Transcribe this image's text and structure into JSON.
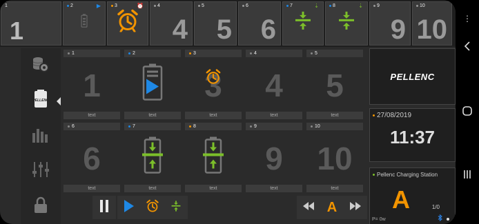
{
  "topbar": {
    "slots": [
      {
        "num": "1",
        "big": "1"
      },
      {
        "num": "2",
        "big": ""
      },
      {
        "num": "3",
        "big": ""
      },
      {
        "num": "4",
        "big": "4"
      },
      {
        "num": "5",
        "big": "5"
      },
      {
        "num": "6",
        "big": "6"
      },
      {
        "num": "7",
        "big": ""
      },
      {
        "num": "8",
        "big": ""
      },
      {
        "num": "9",
        "big": "9"
      },
      {
        "num": "10",
        "big": "10"
      }
    ]
  },
  "sidebar": {
    "items": [
      {
        "icon": "coins-settings-icon"
      },
      {
        "icon": "pellenc-battery-icon"
      },
      {
        "icon": "bar-chart-icon"
      },
      {
        "icon": "sliders-icon"
      },
      {
        "icon": "lock-icon"
      }
    ]
  },
  "grid": {
    "cells": [
      {
        "num": "1",
        "big": "1",
        "label": "text"
      },
      {
        "num": "2",
        "big": "",
        "label": "text"
      },
      {
        "num": "3",
        "big": "3",
        "label": "text"
      },
      {
        "num": "4",
        "big": "4",
        "label": "text"
      },
      {
        "num": "5",
        "big": "5",
        "label": "text"
      },
      {
        "num": "6",
        "big": "6",
        "label": "text"
      },
      {
        "num": "7",
        "big": "",
        "label": "text"
      },
      {
        "num": "8",
        "big": "",
        "label": "text"
      },
      {
        "num": "9",
        "big": "9",
        "label": "text"
      },
      {
        "num": "10",
        "big": "10",
        "label": "text"
      }
    ]
  },
  "controls": {
    "pause_icon": "pause-icon",
    "play_icon": "play-icon",
    "alarm_icon": "alarm-clock-icon",
    "charge_icon": "charge-arrows-icon",
    "rewind_icon": "rewind-icon",
    "current_letter": "A",
    "forward_icon": "fast-forward-icon"
  },
  "right": {
    "brand": "PELLENC",
    "date": "27/08/2019",
    "time": "11:37",
    "station_title": "Pellenc Charging Station",
    "station_letter": "A",
    "station_ratio": "1/0",
    "power": "P= 0w"
  },
  "colors": {
    "accent_orange": "#f29400",
    "accent_blue": "#1e88e5",
    "accent_green": "#7cbf2a",
    "bluetooth": "#2a7ad5"
  }
}
